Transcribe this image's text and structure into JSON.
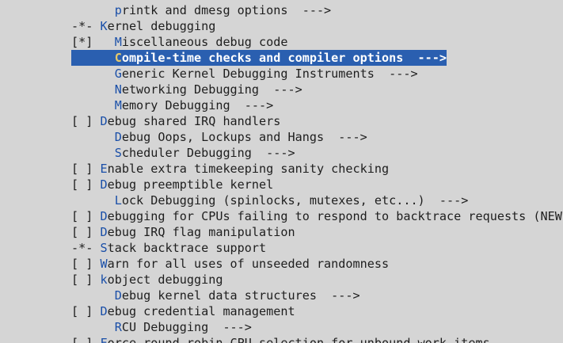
{
  "colors": {
    "background": "#d5d5d5",
    "text": "#1e1e1e",
    "hotkey": "#1a4fa8",
    "selection_bg": "#2a5fb0",
    "selection_text": "#ffffff",
    "selection_hotkey": "#e6c96a"
  },
  "menu": {
    "items": [
      {
        "prefix": "      ",
        "hot": "p",
        "rest": "rintk and dmesg options  --->",
        "selected": false
      },
      {
        "prefix": "-*- ",
        "hot": "K",
        "rest": "ernel debugging",
        "selected": false
      },
      {
        "prefix": "[*]   ",
        "hot": "M",
        "rest": "iscellaneous debug code",
        "selected": false
      },
      {
        "prefix": "      ",
        "hot": "C",
        "rest": "ompile-time checks and compiler options  --->",
        "selected": true
      },
      {
        "prefix": "      ",
        "hot": "G",
        "rest": "eneric Kernel Debugging Instruments  --->",
        "selected": false
      },
      {
        "prefix": "      ",
        "hot": "N",
        "rest": "etworking Debugging  --->",
        "selected": false
      },
      {
        "prefix": "      ",
        "hot": "M",
        "rest": "emory Debugging  --->",
        "selected": false
      },
      {
        "prefix": "[ ] ",
        "hot": "D",
        "rest": "ebug shared IRQ handlers",
        "selected": false
      },
      {
        "prefix": "      ",
        "hot": "D",
        "rest": "ebug Oops, Lockups and Hangs  --->",
        "selected": false
      },
      {
        "prefix": "      ",
        "hot": "S",
        "rest": "cheduler Debugging  --->",
        "selected": false
      },
      {
        "prefix": "[ ] ",
        "hot": "E",
        "rest": "nable extra timekeeping sanity checking",
        "selected": false
      },
      {
        "prefix": "[ ] ",
        "hot": "D",
        "rest": "ebug preemptible kernel",
        "selected": false
      },
      {
        "prefix": "      ",
        "hot": "L",
        "rest": "ock Debugging (spinlocks, mutexes, etc...)  --->",
        "selected": false
      },
      {
        "prefix": "[ ] ",
        "hot": "D",
        "rest": "ebugging for CPUs failing to respond to backtrace requests (NEW)",
        "selected": false
      },
      {
        "prefix": "[ ] ",
        "hot": "D",
        "rest": "ebug IRQ flag manipulation",
        "selected": false
      },
      {
        "prefix": "-*- ",
        "hot": "S",
        "rest": "tack backtrace support",
        "selected": false
      },
      {
        "prefix": "[ ] ",
        "hot": "W",
        "rest": "arn for all uses of unseeded randomness",
        "selected": false
      },
      {
        "prefix": "[ ] ",
        "hot": "k",
        "rest": "object debugging",
        "selected": false
      },
      {
        "prefix": "      ",
        "hot": "D",
        "rest": "ebug kernel data structures  --->",
        "selected": false
      },
      {
        "prefix": "[ ] ",
        "hot": "D",
        "rest": "ebug credential management",
        "selected": false
      },
      {
        "prefix": "      ",
        "hot": "R",
        "rest": "CU Debugging  --->",
        "selected": false
      },
      {
        "prefix": "[ ] ",
        "hot": "F",
        "rest": "orce round-robin CPU selection for unbound work items",
        "selected": false
      }
    ]
  }
}
